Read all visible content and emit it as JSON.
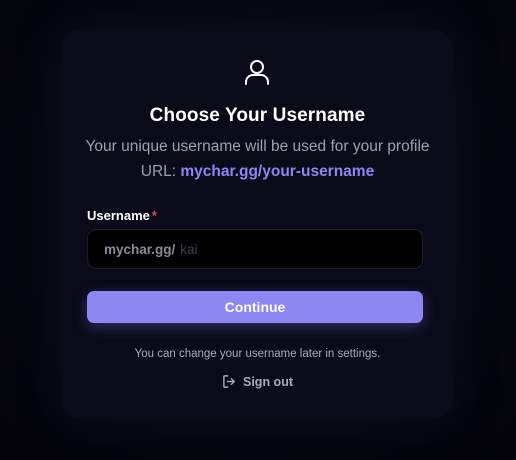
{
  "card": {
    "icon": "user-icon",
    "title": "Choose Your Username",
    "subtitle_prefix": "Your unique username will be used for your profile URL: ",
    "subtitle_url": "mychar.gg/your-username"
  },
  "form": {
    "username_label": "Username",
    "required_mark": "*",
    "url_prefix": "mychar.gg/",
    "username_placeholder": "kai"
  },
  "actions": {
    "continue_label": "Continue",
    "note": "You can change your username later in settings.",
    "signout_icon": "sign-out-icon",
    "signout_label": "Sign out"
  },
  "colors": {
    "accent": "#8c87f2",
    "link": "#8b87f5",
    "required": "#e5484d",
    "card_bg": "#0a0a19"
  }
}
